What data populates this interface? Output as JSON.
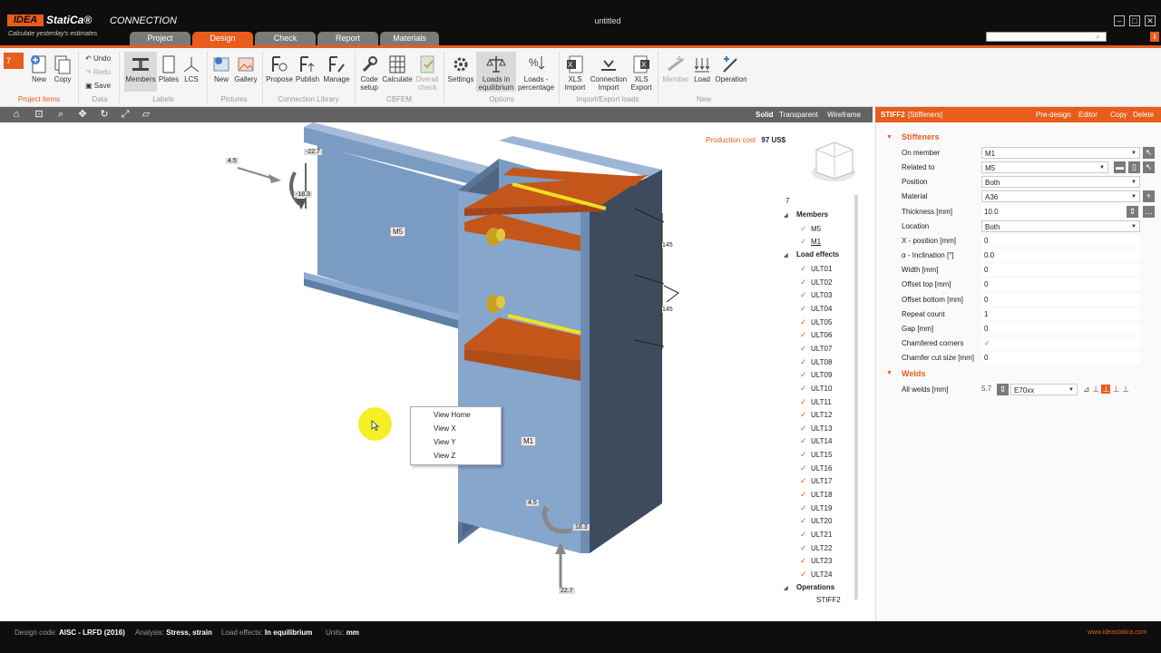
{
  "app": {
    "logo_mark": "IDEA",
    "logo_text": "StatiCa®",
    "product": "CONNECTION",
    "tagline": "Calculate yesterday's estimates",
    "window_title": "untitled",
    "window_controls": [
      "minimize-icon",
      "maximize-icon",
      "close-icon"
    ]
  },
  "search": {
    "placeholder": "",
    "value": ""
  },
  "help_label": "i",
  "tabs": [
    {
      "label": "Project",
      "active": false
    },
    {
      "label": "Design",
      "active": true
    },
    {
      "label": "Check",
      "active": false
    },
    {
      "label": "Report",
      "active": false
    },
    {
      "label": "Materials",
      "active": false
    }
  ],
  "ribbon": {
    "project_number": "7",
    "project_items": {
      "new": "New",
      "copy": "Copy",
      "group": "Project items"
    },
    "data": {
      "undo": "Undo",
      "redo": "Redo",
      "save": "Save",
      "group": "Data"
    },
    "labels": {
      "members": "Members",
      "plates": "Plates",
      "lcs": "LCS",
      "group": "Labels"
    },
    "pictures": {
      "new": "New",
      "gallery": "Gallery",
      "group": "Pictures"
    },
    "library": {
      "propose": "Propose",
      "publish": "Publish",
      "manage": "Manage",
      "group": "Connection Library"
    },
    "cbfem": {
      "code_setup_1": "Code",
      "code_setup_2": "setup",
      "calculate": "Calculate",
      "overall_1": "Overall",
      "overall_2": "check",
      "group": "CBFEM"
    },
    "options": {
      "settings": "Settings",
      "loads_eq_1": "Loads in",
      "loads_eq_2": "equilibrium",
      "loads_pct_1": "Loads -",
      "loads_pct_2": "percentage",
      "group": "Options"
    },
    "import_export": {
      "xls_import_1": "XLS",
      "xls_import_2": "Import",
      "conn_import_1": "Connection",
      "conn_import_2": "Import",
      "xls_export_1": "XLS",
      "xls_export_2": "Export",
      "group": "Import/Export loads"
    },
    "new_group": {
      "member": "Member",
      "load": "Load",
      "operation": "Operation",
      "group": "New"
    }
  },
  "viewport_toolbar": {
    "icons": [
      "home-icon",
      "zoom-window-icon",
      "zoom-icon",
      "pan-icon",
      "rotate-icon",
      "fit-icon",
      "view-icon"
    ],
    "modes": [
      {
        "label": "Solid",
        "active": true
      },
      {
        "label": "Transparent",
        "active": false
      },
      {
        "label": "Wireframe",
        "active": false
      }
    ]
  },
  "production_cost": {
    "label": "Production cost",
    "value": "97 US$"
  },
  "scene_labels": {
    "member_m5": "M5",
    "member_m1": "M1",
    "load_45_top": "4.5",
    "load_227_top": "-22.7",
    "load_183_top": "-18.3",
    "dim_145_upper": "145",
    "dim_145_lower": "145",
    "load_45_bottom": "4.5",
    "load_183_bottom": "18.3",
    "load_227_bottom": "22.7"
  },
  "tree": {
    "root": "7",
    "members_head": "Members",
    "members": [
      {
        "label": "M5",
        "underlined": false
      },
      {
        "label": "M1",
        "underlined": true
      }
    ],
    "load_effects_head": "Load effects",
    "load_effects": [
      "ULT01",
      "ULT02",
      "ULT03",
      "ULT04",
      "ULT05",
      "ULT06",
      "ULT07",
      "ULT08",
      "ULT09",
      "ULT10",
      "ULT11",
      "ULT12",
      "ULT13",
      "ULT14",
      "ULT15",
      "ULT16",
      "ULT17",
      "ULT18",
      "ULT19",
      "ULT20",
      "ULT21",
      "ULT22",
      "ULT23",
      "ULT24"
    ],
    "operations_head": "Operations",
    "operations_first": "STIFF2"
  },
  "context_menu": [
    "View Home",
    "View X",
    "View Y",
    "View Z"
  ],
  "props_header": {
    "name": "STIFF2",
    "type": "[Stiffeners]",
    "actions": [
      "Pre-design",
      "Editor",
      "Copy",
      "Delete"
    ]
  },
  "stiffeners": {
    "title": "Stiffeners",
    "rows": [
      {
        "label": "On member",
        "value": "M1",
        "kind": "combo"
      },
      {
        "label": "Related to",
        "value": "M5",
        "kind": "combo"
      },
      {
        "label": "Position",
        "value": "Both",
        "kind": "combo"
      },
      {
        "label": "Material",
        "value": "A36",
        "kind": "combo"
      },
      {
        "label": "Thickness [mm]",
        "value": "10.0",
        "kind": "spin"
      },
      {
        "label": "Location",
        "value": "Both",
        "kind": "combo"
      },
      {
        "label": "X - position [mm]",
        "value": "0",
        "kind": "text"
      },
      {
        "label": "α - Inclination [°]",
        "value": "0.0",
        "kind": "text"
      },
      {
        "label": "Width [mm]",
        "value": "0",
        "kind": "text"
      },
      {
        "label": "Offset top [mm]",
        "value": "0",
        "kind": "text"
      },
      {
        "label": "Offset bottom [mm]",
        "value": "0",
        "kind": "text"
      },
      {
        "label": "Repeat count",
        "value": "1",
        "kind": "text"
      },
      {
        "label": "Gap [mm]",
        "value": "0",
        "kind": "text"
      },
      {
        "label": "Chamfered corners",
        "value": "✓",
        "kind": "check"
      },
      {
        "label": "Chamfer cut size [mm]",
        "value": "0",
        "kind": "text"
      }
    ]
  },
  "welds": {
    "title": "Welds",
    "label": "All welds [mm]",
    "size": "5.7",
    "type": "E70xx"
  },
  "status": {
    "design_code_label": "Design code:",
    "design_code": "AISC - LRFD (2016)",
    "analysis_label": "Analysis:",
    "analysis": "Stress, strain",
    "load_effects_label": "Load effects:",
    "load_effects": "In equilibrium",
    "units_label": "Units:",
    "units": "mm",
    "website": "www.ideastatica.com"
  },
  "colors": {
    "accent": "#e85d1c",
    "steel": "#7b9cc2",
    "steel_dark": "#3d4b5c",
    "stiffener": "#c4561a",
    "weld": "#f0e020"
  }
}
